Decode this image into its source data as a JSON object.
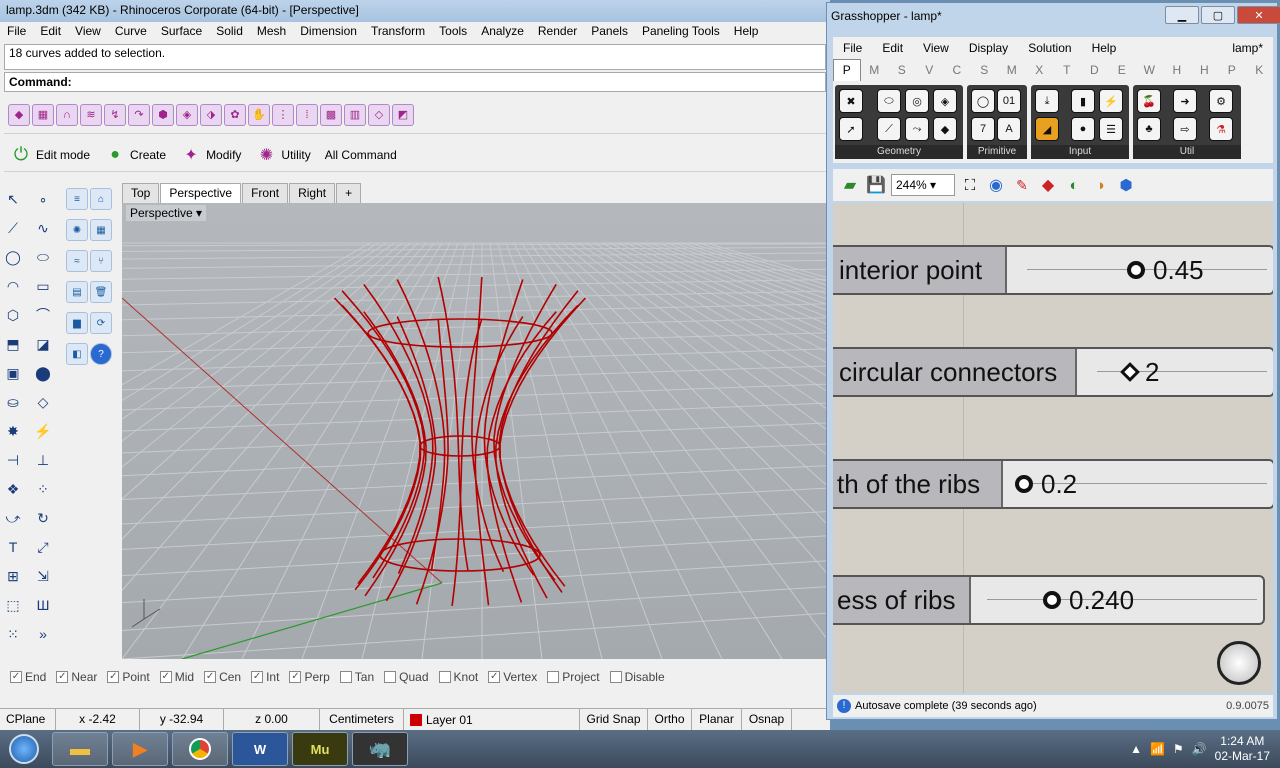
{
  "rhino": {
    "title": "lamp.3dm (342 KB) - Rhinoceros Corporate (64-bit) - [Perspective]",
    "menu": [
      "File",
      "Edit",
      "View",
      "Curve",
      "Surface",
      "Solid",
      "Mesh",
      "Dimension",
      "Transform",
      "Tools",
      "Analyze",
      "Render",
      "Panels",
      "Paneling Tools",
      "Help"
    ],
    "history": "18 curves added to selection.",
    "command_label": "Command:",
    "toolbar2": [
      "Edit mode",
      "Create",
      "Modify",
      "Utility",
      "All Command"
    ],
    "viewport_tabs": [
      "Top",
      "Perspective",
      "Front",
      "Right"
    ],
    "viewport_label": "Perspective",
    "osnaps": [
      {
        "label": "End",
        "checked": true
      },
      {
        "label": "Near",
        "checked": true
      },
      {
        "label": "Point",
        "checked": true
      },
      {
        "label": "Mid",
        "checked": true
      },
      {
        "label": "Cen",
        "checked": true
      },
      {
        "label": "Int",
        "checked": true
      },
      {
        "label": "Perp",
        "checked": true
      },
      {
        "label": "Tan",
        "checked": false
      },
      {
        "label": "Quad",
        "checked": false
      },
      {
        "label": "Knot",
        "checked": false
      },
      {
        "label": "Vertex",
        "checked": true
      },
      {
        "label": "Project",
        "checked": false
      },
      {
        "label": "Disable",
        "checked": false
      }
    ],
    "status": {
      "cplane": "CPlane",
      "x": "x -2.42",
      "y": "y -32.94",
      "z": "z 0.00",
      "units": "Centimeters",
      "layer": "Layer 01",
      "grid_snap": "Grid Snap",
      "ortho": "Ortho",
      "planar": "Planar",
      "osnap": "Osnap"
    },
    "layer_color": "#cc0000",
    "curve_color": "#b30000"
  },
  "gh": {
    "title": "Grasshopper - lamp*",
    "menu": [
      "File",
      "Edit",
      "View",
      "Display",
      "Solution",
      "Help"
    ],
    "doc": "lamp*",
    "tabs": [
      "P",
      "M",
      "S",
      "V",
      "C",
      "S",
      "M",
      "X",
      "T",
      "D",
      "E",
      "W",
      "H",
      "H",
      "P",
      "K"
    ],
    "groups": [
      "Geometry",
      "Primitive",
      "Input",
      "Util"
    ],
    "zoom": "244%",
    "sliders": [
      {
        "label": "interior point",
        "value": "0.45",
        "fraction": 0.48
      },
      {
        "label": "circular connectors",
        "value": "2",
        "fraction": 0.0
      },
      {
        "label": "th of the ribs",
        "value": "0.2",
        "fraction": 0.0
      },
      {
        "label": "ess of ribs",
        "value": "0.240",
        "fraction": 0.25
      }
    ],
    "status": "Autosave complete (39 seconds ago)",
    "version": "0.9.0075"
  },
  "taskbar": {
    "apps": [
      "W",
      "Mu"
    ],
    "time": "1:24 AM",
    "date": "02-Mar-17"
  }
}
